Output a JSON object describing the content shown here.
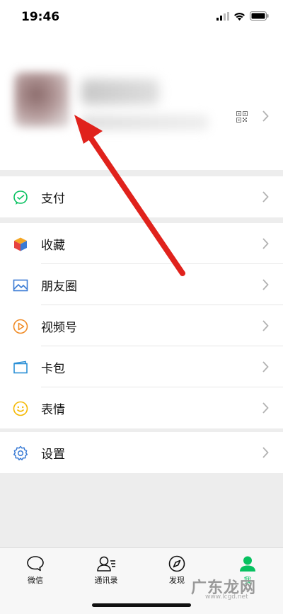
{
  "status_bar": {
    "time": "19:46"
  },
  "menu": {
    "pay": "支付",
    "favorites": "收藏",
    "moments": "朋友圈",
    "channels": "视频号",
    "cards": "卡包",
    "stickers": "表情",
    "settings": "设置"
  },
  "tabs": {
    "chats": "微信",
    "contacts": "通讯录",
    "discover": "发现",
    "me": "我"
  },
  "watermark": {
    "text": "广东龙网",
    "url": "www.lcgd.net"
  },
  "colors": {
    "accent_green": "#07c160",
    "arrow_red": "#e0221c",
    "settings_blue": "#3a7bd5"
  }
}
